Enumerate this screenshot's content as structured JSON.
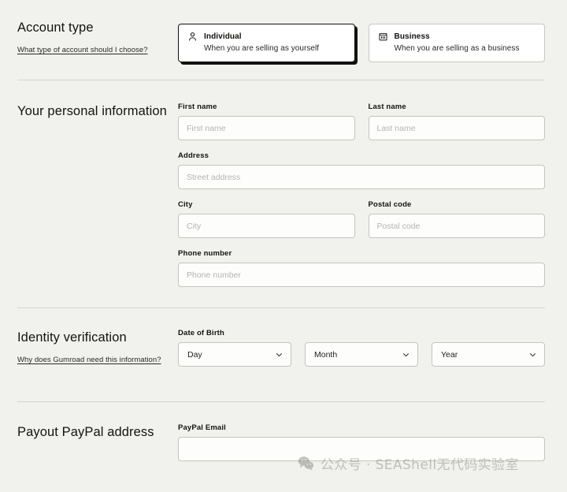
{
  "theme": {
    "background": "#f1f2ed",
    "text": "#121210",
    "border": "#c3c4bd",
    "divider": "#d3d4cd",
    "input_background": "#fdfdfc",
    "placeholder": "#b4b5ae",
    "selected_border": "#121210"
  },
  "account_type": {
    "title": "Account type",
    "help_link": "What type of account should I choose?",
    "options": [
      {
        "id": "individual",
        "icon": "person-icon",
        "name": "Individual",
        "description": "When you are selling as yourself",
        "selected": true
      },
      {
        "id": "business",
        "icon": "building-icon",
        "name": "Business",
        "description": "When you are selling as a business",
        "selected": false
      }
    ]
  },
  "personal_information": {
    "title": "Your personal information",
    "fields": {
      "first_name": {
        "label": "First name",
        "placeholder": "First name",
        "value": ""
      },
      "last_name": {
        "label": "Last name",
        "placeholder": "Last name",
        "value": ""
      },
      "address": {
        "label": "Address",
        "placeholder": "Street address",
        "value": ""
      },
      "city": {
        "label": "City",
        "placeholder": "City",
        "value": ""
      },
      "postal_code": {
        "label": "Postal code",
        "placeholder": "Postal code",
        "value": ""
      },
      "phone_number": {
        "label": "Phone number",
        "placeholder": "Phone number",
        "value": ""
      }
    }
  },
  "identity_verification": {
    "title": "Identity verification",
    "help_link": "Why does Gumroad need this information?",
    "date_of_birth": {
      "label": "Date of Birth",
      "day": {
        "selected": "Day",
        "icon": "chevron-down-icon"
      },
      "month": {
        "selected": "Month",
        "icon": "chevron-down-icon"
      },
      "year": {
        "selected": "Year",
        "icon": "chevron-down-icon"
      }
    }
  },
  "payout": {
    "title": "Payout PayPal address",
    "paypal_email": {
      "label": "PayPal Email",
      "placeholder": "",
      "value": ""
    }
  },
  "watermark": {
    "icon": "wechat-icon",
    "text": "公众号 · SEAShell无代码实验室"
  }
}
